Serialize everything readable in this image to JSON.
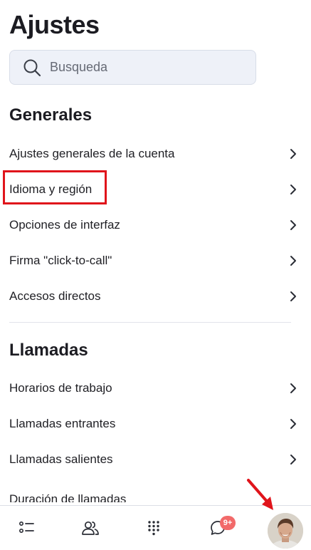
{
  "header": {
    "title": "Ajustes"
  },
  "search": {
    "placeholder": "Busqueda"
  },
  "sections": [
    {
      "title": "Generales",
      "items": [
        {
          "label": "Ajustes generales de la cuenta"
        },
        {
          "label": "Idioma y región"
        },
        {
          "label": "Opciones de interfaz"
        },
        {
          "label": "Firma \"click-to-call\""
        },
        {
          "label": "Accesos directos"
        }
      ]
    },
    {
      "title": "Llamadas",
      "items": [
        {
          "label": "Horarios de trabajo"
        },
        {
          "label": "Llamadas entrantes"
        },
        {
          "label": "Llamadas salientes"
        },
        {
          "label": "Duración de llamadas"
        }
      ]
    }
  ],
  "bottom_nav": {
    "items": [
      {
        "icon": "list-icon"
      },
      {
        "icon": "contacts-icon"
      },
      {
        "icon": "dialpad-icon"
      },
      {
        "icon": "chat-icon",
        "badge": "9+"
      },
      {
        "icon": "avatar"
      }
    ]
  },
  "colors": {
    "highlight": "#e0141b",
    "badge": "#f26a6a",
    "search_bg": "#eef1f8"
  }
}
